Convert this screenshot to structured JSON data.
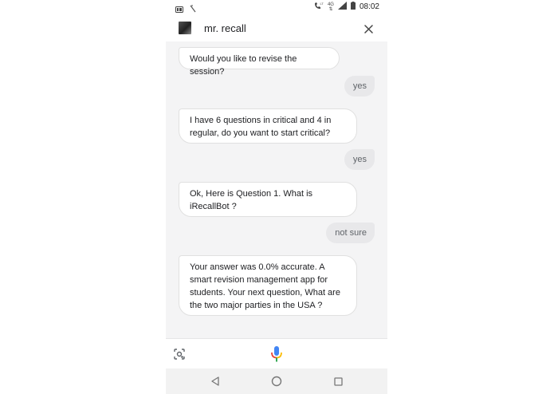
{
  "status_bar": {
    "time": "08:02",
    "network_top": "LTE",
    "network": "4G",
    "icons": [
      "sim-card-icon",
      "call-indicator-icon",
      "wifi-calling-icon",
      "signal-icon",
      "battery-icon"
    ]
  },
  "header": {
    "title": "mr. recall",
    "icons": [
      "avatar",
      "close-icon"
    ]
  },
  "messages": [
    {
      "role": "bot",
      "text": "Would you like to revise the session?"
    },
    {
      "role": "user",
      "text": "yes"
    },
    {
      "role": "bot",
      "text": "I have 6 questions in critical and 4 in regular, do you want to start critical?"
    },
    {
      "role": "user",
      "text": "yes"
    },
    {
      "role": "bot",
      "text": "Ok, Here is Question 1.  What is iRecallBot ?"
    },
    {
      "role": "user",
      "text": "not sure"
    },
    {
      "role": "bot",
      "text": "Your answer was 0.0% accurate. A smart revision management app for students. Your next question,  What are the two major parties in the USA ?"
    }
  ],
  "input_bar": {
    "icons": [
      "lens-icon",
      "mic-icon"
    ]
  },
  "nav_bar": {
    "icons": [
      "back-icon",
      "home-icon",
      "recents-icon"
    ]
  },
  "colors": {
    "mic_blue": "#4285f4",
    "mic_red": "#ea4335",
    "mic_yellow": "#fbbc05",
    "mic_green": "#34a853"
  }
}
